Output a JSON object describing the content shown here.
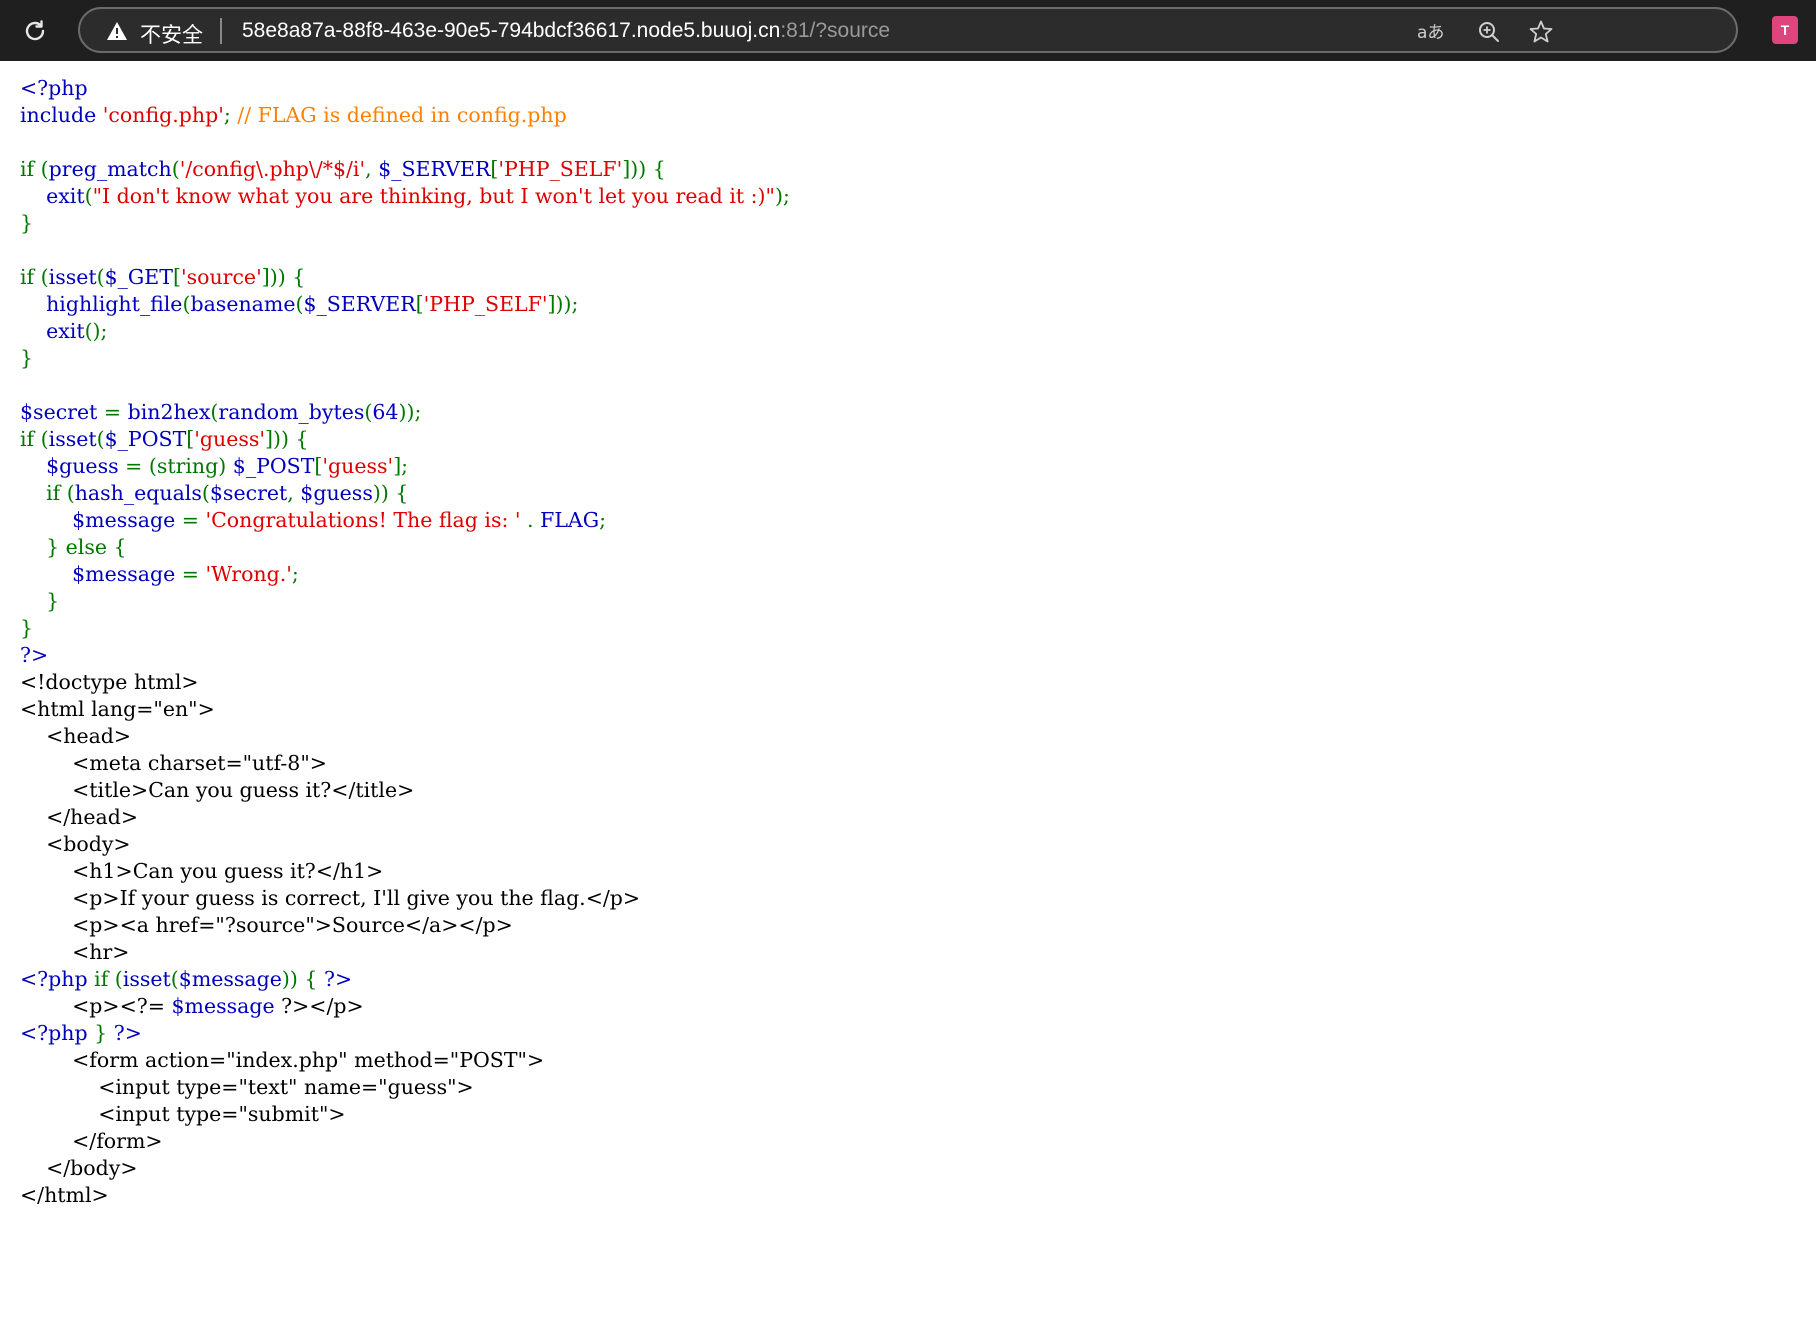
{
  "browser": {
    "security_label": "不安全",
    "url_main": "58e8a87a-88f8-463e-90e5-794bdcf36617.node5.buuoj.cn",
    "url_port_path": ":81/?source",
    "extension_badge": "T"
  },
  "code_lines": [
    [
      [
        "d",
        "<?php"
      ]
    ],
    [
      [
        "d",
        "include "
      ],
      [
        "s",
        "'config.php'"
      ],
      [
        "k",
        ";"
      ],
      [
        "c",
        " // FLAG is defined in config.php"
      ]
    ],
    [],
    [
      [
        "k",
        "if ("
      ],
      [
        "d",
        "preg_match"
      ],
      [
        "k",
        "("
      ],
      [
        "s",
        "'/config\\.php\\/*$/i'"
      ],
      [
        "k",
        ", "
      ],
      [
        "d",
        "$_SERVER"
      ],
      [
        "k",
        "["
      ],
      [
        "s",
        "'PHP_SELF'"
      ],
      [
        "k",
        "])) {"
      ]
    ],
    [
      [
        "d",
        "    exit"
      ],
      [
        "k",
        "("
      ],
      [
        "s",
        "\"I don't know what you are thinking, but I won't let you read it :)\""
      ],
      [
        "k",
        ");"
      ]
    ],
    [
      [
        "k",
        "}"
      ]
    ],
    [],
    [
      [
        "k",
        "if ("
      ],
      [
        "d",
        "isset"
      ],
      [
        "k",
        "("
      ],
      [
        "d",
        "$_GET"
      ],
      [
        "k",
        "["
      ],
      [
        "s",
        "'source'"
      ],
      [
        "k",
        "])) {"
      ]
    ],
    [
      [
        "d",
        "    highlight_file"
      ],
      [
        "k",
        "("
      ],
      [
        "d",
        "basename"
      ],
      [
        "k",
        "("
      ],
      [
        "d",
        "$_SERVER"
      ],
      [
        "k",
        "["
      ],
      [
        "s",
        "'PHP_SELF'"
      ],
      [
        "k",
        "]));"
      ]
    ],
    [
      [
        "d",
        "    exit"
      ],
      [
        "k",
        "();"
      ]
    ],
    [
      [
        "k",
        "}"
      ]
    ],
    [],
    [
      [
        "d",
        "$secret "
      ],
      [
        "k",
        "= "
      ],
      [
        "d",
        "bin2hex"
      ],
      [
        "k",
        "("
      ],
      [
        "d",
        "random_bytes"
      ],
      [
        "k",
        "("
      ],
      [
        "d",
        "64"
      ],
      [
        "k",
        "));"
      ]
    ],
    [
      [
        "k",
        "if ("
      ],
      [
        "d",
        "isset"
      ],
      [
        "k",
        "("
      ],
      [
        "d",
        "$_POST"
      ],
      [
        "k",
        "["
      ],
      [
        "s",
        "'guess'"
      ],
      [
        "k",
        "])) {"
      ]
    ],
    [
      [
        "d",
        "    $guess "
      ],
      [
        "k",
        "= (string) "
      ],
      [
        "d",
        "$_POST"
      ],
      [
        "k",
        "["
      ],
      [
        "s",
        "'guess'"
      ],
      [
        "k",
        "];"
      ]
    ],
    [
      [
        "k",
        "    if ("
      ],
      [
        "d",
        "hash_equals"
      ],
      [
        "k",
        "("
      ],
      [
        "d",
        "$secret"
      ],
      [
        "k",
        ", "
      ],
      [
        "d",
        "$guess"
      ],
      [
        "k",
        ")) {"
      ]
    ],
    [
      [
        "d",
        "        $message "
      ],
      [
        "k",
        "= "
      ],
      [
        "s",
        "'Congratulations! The flag is: ' "
      ],
      [
        "k",
        ". "
      ],
      [
        "d",
        "FLAG"
      ],
      [
        "k",
        ";"
      ]
    ],
    [
      [
        "k",
        "    } else {"
      ]
    ],
    [
      [
        "d",
        "        $message "
      ],
      [
        "k",
        "= "
      ],
      [
        "s",
        "'Wrong.'"
      ],
      [
        "k",
        ";"
      ]
    ],
    [
      [
        "k",
        "    }"
      ]
    ],
    [
      [
        "k",
        "}"
      ]
    ],
    [
      [
        "d",
        "?>"
      ]
    ],
    [
      [
        "h",
        "<!doctype html>"
      ]
    ],
    [
      [
        "h",
        "<html lang=\"en\">"
      ]
    ],
    [
      [
        "h",
        "    <head>"
      ]
    ],
    [
      [
        "h",
        "        <meta charset=\"utf-8\">"
      ]
    ],
    [
      [
        "h",
        "        <title>Can you guess it?</title>"
      ]
    ],
    [
      [
        "h",
        "    </head>"
      ]
    ],
    [
      [
        "h",
        "    <body>"
      ]
    ],
    [
      [
        "h",
        "        <h1>Can you guess it?</h1>"
      ]
    ],
    [
      [
        "h",
        "        <p>If your guess is correct, I'll give you the flag.</p>"
      ]
    ],
    [
      [
        "h",
        "        <p><a href=\"?source\">Source</a></p>"
      ]
    ],
    [
      [
        "h",
        "        <hr>"
      ]
    ],
    [
      [
        "d",
        "<?php "
      ],
      [
        "k",
        "if ("
      ],
      [
        "d",
        "isset"
      ],
      [
        "k",
        "("
      ],
      [
        "d",
        "$message"
      ],
      [
        "k",
        ")) { "
      ],
      [
        "d",
        "?>"
      ]
    ],
    [
      [
        "h",
        "        <p><?= "
      ],
      [
        "d",
        "$message "
      ],
      [
        "h",
        "?></p>"
      ]
    ],
    [
      [
        "d",
        "<?php "
      ],
      [
        "k",
        "} "
      ],
      [
        "d",
        "?>"
      ]
    ],
    [
      [
        "h",
        "        <form action=\"index.php\" method=\"POST\">"
      ]
    ],
    [
      [
        "h",
        "            <input type=\"text\" name=\"guess\">"
      ]
    ],
    [
      [
        "h",
        "            <input type=\"submit\">"
      ]
    ],
    [
      [
        "h",
        "        </form>"
      ]
    ],
    [
      [
        "h",
        "    </body>"
      ]
    ],
    [
      [
        "h",
        "</html>"
      ]
    ]
  ]
}
